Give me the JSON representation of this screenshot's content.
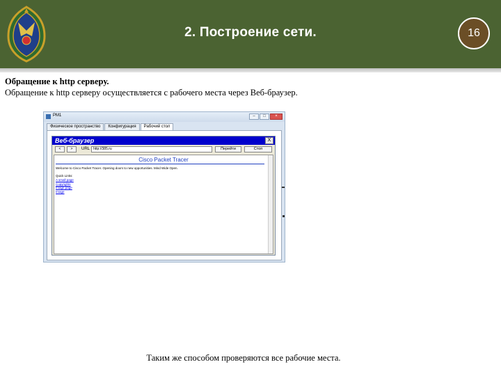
{
  "header": {
    "title": "2.  Построение сети.",
    "page_number": "16",
    "emblem_icon": "military-emblem-icon",
    "colors": {
      "band": "#4b6332",
      "badge": "#6b4e26"
    }
  },
  "content": {
    "heading": "Обращение к http серверу.",
    "description": "Обращение к http серверу осуществляется с рабочего места через Веб-браузер.",
    "footer_note": "Таким же способом проверяются все рабочие места."
  },
  "pm_window": {
    "title": "PM1",
    "tabs": [
      {
        "label": "Физическое пространство",
        "active": false
      },
      {
        "label": "Конфигурация",
        "active": false
      },
      {
        "label": "Рабочий стол",
        "active": true
      }
    ],
    "browser": {
      "title": "Веб-браузер",
      "close_label": "X",
      "back_label": "<",
      "forward_label": ">",
      "url_label": "URL",
      "url_value": "http://385.ru",
      "go_label": "Перейти",
      "stop_label": "Стоп",
      "page": {
        "heading": "Cisco Packet Tracer",
        "welcome": "Welcome to Cisco Packet Tracer. Opening doors to new opportunities. Mind Wide Open.",
        "quick_links_title": "Quick Links:",
        "links": [
          "A small page",
          "Copyrights",
          "Image page",
          "Image"
        ]
      }
    }
  }
}
